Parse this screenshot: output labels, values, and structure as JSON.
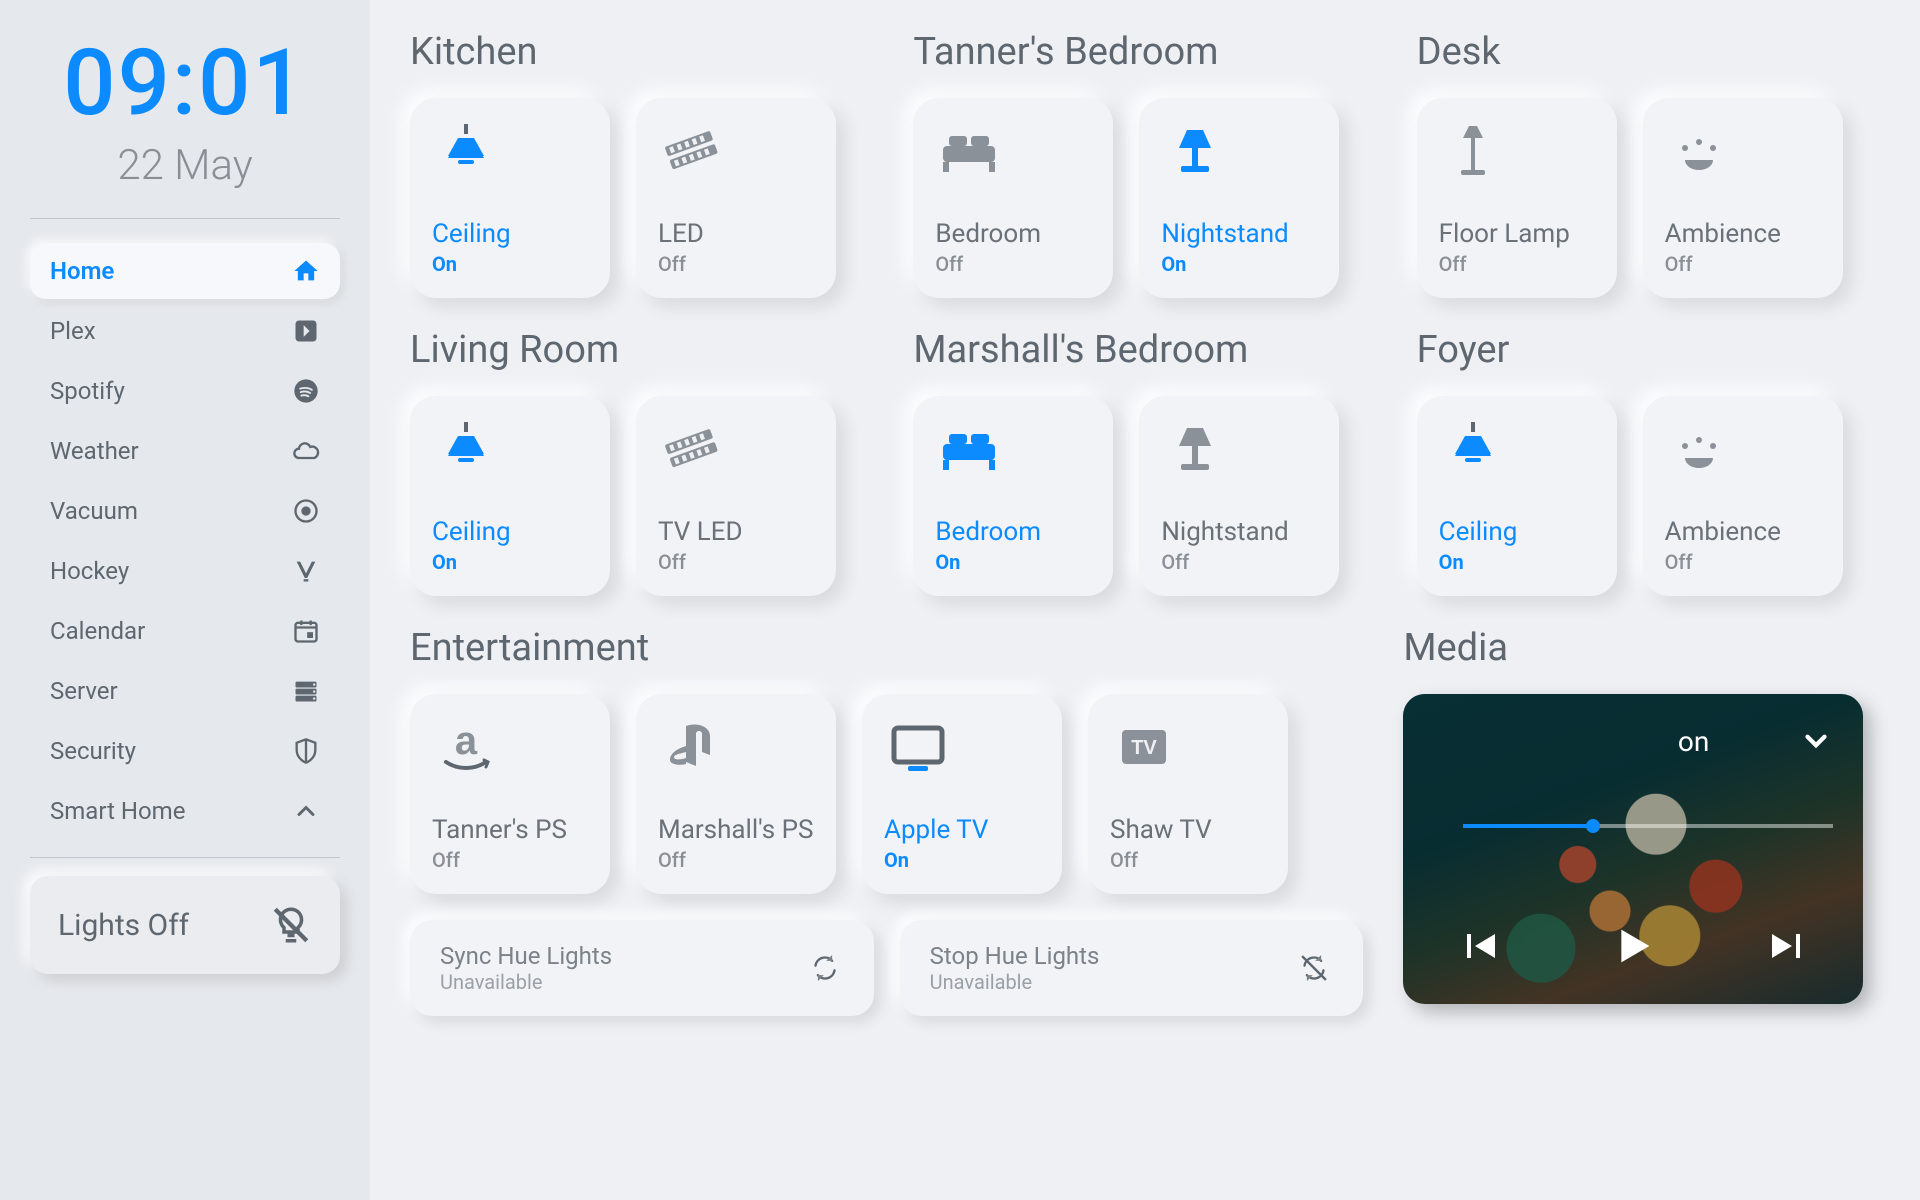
{
  "clock": {
    "time": "09:01",
    "date": "22 May"
  },
  "sidebar": {
    "items": [
      {
        "label": "Home",
        "icon": "home",
        "active": true
      },
      {
        "label": "Plex",
        "icon": "plex"
      },
      {
        "label": "Spotify",
        "icon": "spotify"
      },
      {
        "label": "Weather",
        "icon": "cloud"
      },
      {
        "label": "Vacuum",
        "icon": "target"
      },
      {
        "label": "Hockey",
        "icon": "hockey"
      },
      {
        "label": "Calendar",
        "icon": "calendar"
      },
      {
        "label": "Server",
        "icon": "server"
      },
      {
        "label": "Security",
        "icon": "shield"
      },
      {
        "label": "Smart Home",
        "icon": "chevron-up"
      }
    ],
    "lights_off": {
      "label": "Lights Off"
    }
  },
  "rooms": [
    {
      "title": "Kitchen",
      "tiles": [
        {
          "name": "Ceiling",
          "state": "On",
          "icon": "ceiling-light",
          "on": true
        },
        {
          "name": "LED",
          "state": "Off",
          "icon": "filmstrip",
          "on": false
        }
      ]
    },
    {
      "title": "Tanner's Bedroom",
      "tiles": [
        {
          "name": "Bedroom",
          "state": "Off",
          "icon": "bed",
          "on": false
        },
        {
          "name": "Nightstand",
          "state": "On",
          "icon": "table-lamp",
          "on": true
        }
      ]
    },
    {
      "title": "Desk",
      "tiles": [
        {
          "name": "Floor Lamp",
          "state": "Off",
          "icon": "floor-lamp",
          "on": false
        },
        {
          "name": "Ambience",
          "state": "Off",
          "icon": "ambience",
          "on": false
        }
      ]
    },
    {
      "title": "Living Room",
      "tiles": [
        {
          "name": "Ceiling",
          "state": "On",
          "icon": "ceiling-light",
          "on": true
        },
        {
          "name": "TV LED",
          "state": "Off",
          "icon": "filmstrip",
          "on": false
        }
      ]
    },
    {
      "title": "Marshall's Bedroom",
      "tiles": [
        {
          "name": "Bedroom",
          "state": "On",
          "icon": "bed",
          "on": true
        },
        {
          "name": "Nightstand",
          "state": "Off",
          "icon": "table-lamp",
          "on": false
        }
      ]
    },
    {
      "title": "Foyer",
      "tiles": [
        {
          "name": "Ceiling",
          "state": "On",
          "icon": "ceiling-light",
          "on": true
        },
        {
          "name": "Ambience",
          "state": "Off",
          "icon": "ambience",
          "on": false
        }
      ]
    }
  ],
  "entertainment": {
    "title": "Entertainment",
    "tiles": [
      {
        "name": "Tanner's PS",
        "state": "Off",
        "icon": "amazon",
        "on": false
      },
      {
        "name": "Marshall's PS",
        "state": "Off",
        "icon": "playstation",
        "on": false
      },
      {
        "name": "Apple TV",
        "state": "On",
        "icon": "tv",
        "on": true
      },
      {
        "name": "Shaw TV",
        "state": "Off",
        "icon": "tv-box",
        "on": false
      }
    ],
    "hue": [
      {
        "title": "Sync Hue Lights",
        "sub": "Unavailable",
        "icon": "sync"
      },
      {
        "title": "Stop Hue Lights",
        "sub": "Unavailable",
        "icon": "sync-off"
      }
    ]
  },
  "media": {
    "title": "Media",
    "now_playing_fragment": "on",
    "progress_pct": 35
  },
  "colors": {
    "accent": "#0b8bff"
  }
}
